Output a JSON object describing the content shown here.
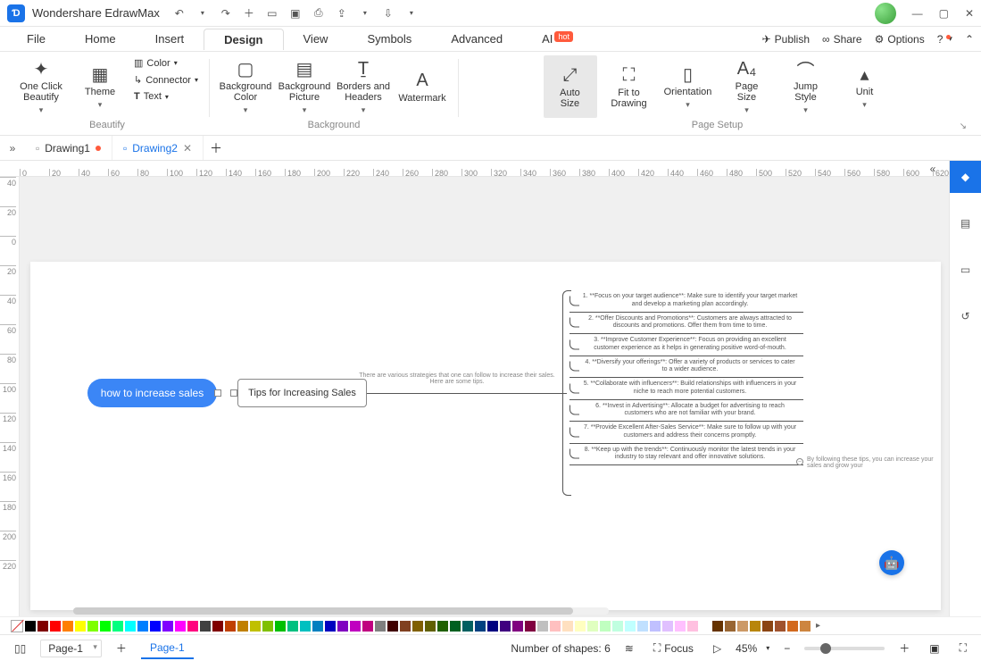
{
  "app": {
    "title": "Wondershare EdrawMax"
  },
  "menus": {
    "file": "File",
    "home": "Home",
    "insert": "Insert",
    "design": "Design",
    "view": "View",
    "symbols": "Symbols",
    "advanced": "Advanced",
    "ai": "AI",
    "ai_badge": "hot",
    "publish": "Publish",
    "share": "Share",
    "options": "Options"
  },
  "ribbon": {
    "beautify": {
      "one_click": "One Click\nBeautify",
      "theme": "Theme",
      "color": "Color",
      "connector": "Connector",
      "text": "Text",
      "group": "Beautify"
    },
    "background": {
      "bg_color": "Background\nColor",
      "bg_pic": "Background\nPicture",
      "borders": "Borders and\nHeaders",
      "watermark": "Watermark",
      "group": "Background"
    },
    "page_setup": {
      "auto_size": "Auto\nSize",
      "fit": "Fit to\nDrawing",
      "orientation": "Orientation",
      "page_size": "Page\nSize",
      "jump_style": "Jump\nStyle",
      "unit": "Unit",
      "group": "Page Setup"
    }
  },
  "tabs": {
    "t1": "Drawing1",
    "t2": "Drawing2"
  },
  "ruler_top": [
    0,
    20,
    40,
    60,
    80,
    100,
    120,
    140,
    160,
    180,
    200,
    220,
    240,
    260,
    280,
    300,
    320,
    340,
    360,
    380,
    400,
    420,
    440,
    460,
    480,
    500,
    520,
    540,
    560,
    580,
    600,
    620
  ],
  "ruler_left": [
    40,
    20,
    0,
    20,
    40,
    60,
    80,
    100,
    120,
    140,
    160,
    180,
    200,
    220
  ],
  "mindmap": {
    "root": "how to increase sales",
    "sub": "Tips for Increasing Sales",
    "summary": "There are various strategies that one can follow to increase their sales. Here are some tips.",
    "branches": [
      "1. **Focus on your target audience**: Make sure to identify your target market and develop a marketing plan accordingly.",
      "2. **Offer Discounts and Promotions**: Customers are always attracted to discounts and promotions. Offer them from time to time.",
      "3. **Improve Customer Experience**: Focus on providing an excellent customer experience as it helps in generating positive word-of-mouth.",
      "4. **Diversify your offerings**: Offer a variety of products or services to cater to a wider audience.",
      "5. **Collaborate with influencers**: Build relationships with influencers in your niche to reach more potential customers.",
      "6. **Invest in Advertising**: Allocate a budget for advertising to reach customers who are not familiar with your brand.",
      "7. **Provide Excellent After-Sales Service**: Make sure to follow up with your customers and address their concerns promptly.",
      "8. **Keep up with the trends**: Continuously monitor the latest trends in your industry to stay relevant and offer innovative solutions."
    ],
    "followup": "By following these tips, you can increase your sales and grow your"
  },
  "status": {
    "page_dd": "Page-1",
    "page_tab": "Page-1",
    "shapes": "Number of shapes: 6",
    "focus": "Focus",
    "zoom": "45%"
  },
  "palette": [
    "#000000",
    "#7f0000",
    "#ff0000",
    "#ff7f00",
    "#ffff00",
    "#7fff00",
    "#00ff00",
    "#00ff7f",
    "#00ffff",
    "#007fff",
    "#0000ff",
    "#7f00ff",
    "#ff00ff",
    "#ff007f",
    "#404040",
    "#800000",
    "#c04000",
    "#c08000",
    "#c0c000",
    "#80c000",
    "#00c000",
    "#00c080",
    "#00c0c0",
    "#0080c0",
    "#0000c0",
    "#8000c0",
    "#c000c0",
    "#c00080",
    "#808080",
    "#400000",
    "#804020",
    "#806000",
    "#606000",
    "#206000",
    "#006020",
    "#006060",
    "#004080",
    "#000080",
    "#400080",
    "#800080",
    "#800040",
    "#c0c0c0",
    "#ffc0c0",
    "#ffe0c0",
    "#ffffc0",
    "#e0ffc0",
    "#c0ffc0",
    "#c0ffe0",
    "#c0ffff",
    "#c0e0ff",
    "#c0c0ff",
    "#e0c0ff",
    "#ffc0ff",
    "#ffc0e0",
    "#ffffff",
    "#663300",
    "#996633",
    "#cc9966",
    "#b8860b",
    "#8b4513",
    "#a0522d",
    "#d2691e",
    "#cd853f"
  ]
}
